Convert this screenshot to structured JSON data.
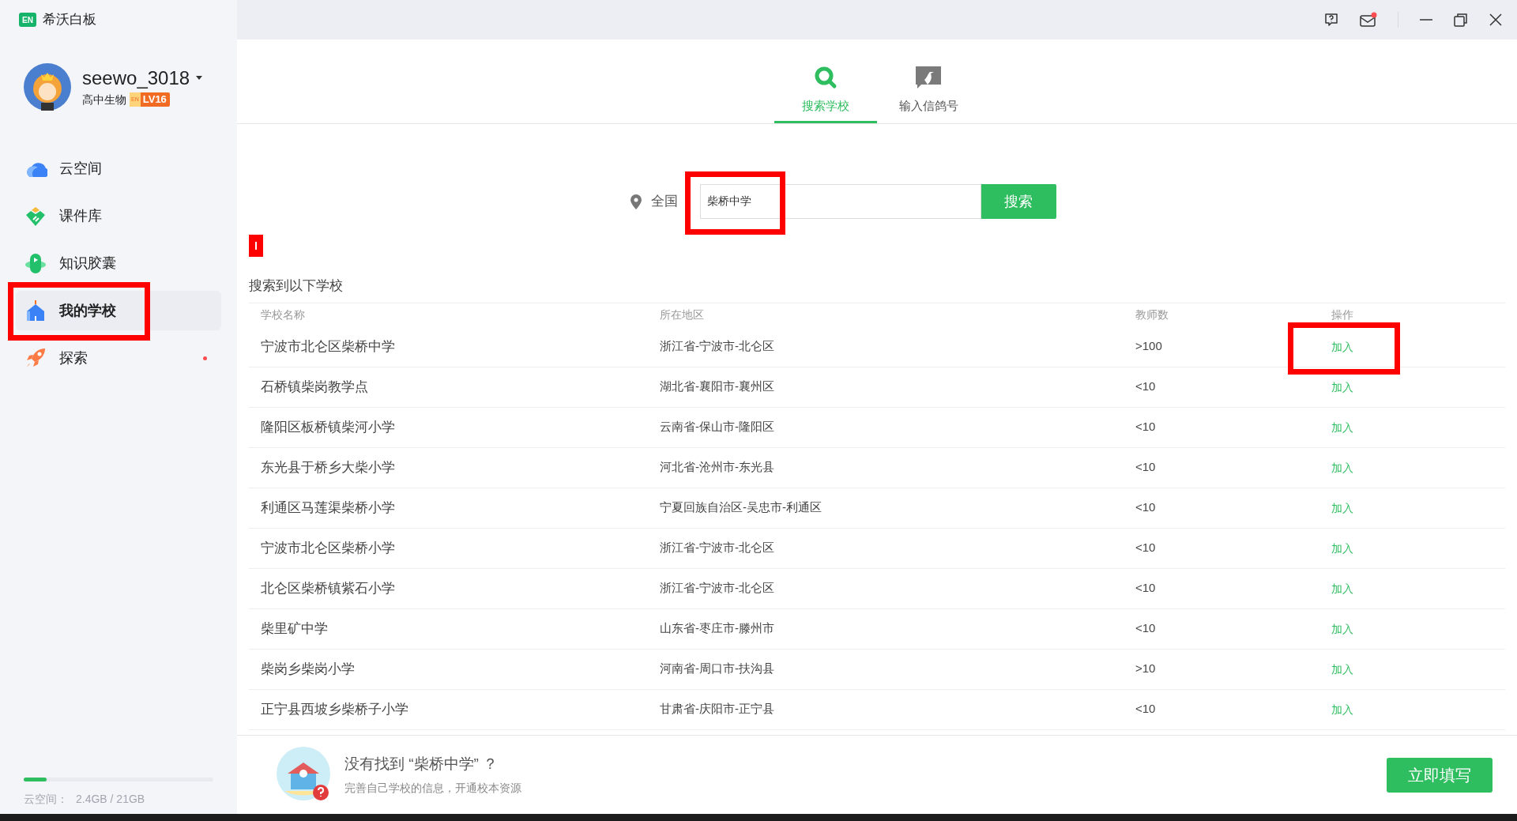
{
  "app": {
    "title": "希沃白板",
    "logo": "EN"
  },
  "window_controls": {
    "mail_unread": true
  },
  "user": {
    "name": "seewo_3018",
    "subject": "高中生物",
    "badge_logo": "EN",
    "level": "LV16"
  },
  "sidebar": {
    "items": [
      {
        "label": "云空间",
        "selected": false,
        "highlighted": false,
        "dot": false
      },
      {
        "label": "课件库",
        "selected": false,
        "highlighted": false,
        "dot": false
      },
      {
        "label": "知识胶囊",
        "selected": false,
        "highlighted": false,
        "dot": false
      },
      {
        "label": "我的学校",
        "selected": true,
        "highlighted": true,
        "dot": false
      },
      {
        "label": "探索",
        "selected": false,
        "highlighted": false,
        "dot": true
      }
    ]
  },
  "storage": {
    "level": 0.12,
    "label": "云空间：",
    "usage": "2.4GB / 21GB"
  },
  "tabs": [
    {
      "label": "搜索学校",
      "selected": true
    },
    {
      "label": "输入信鸽号",
      "selected": false
    }
  ],
  "search": {
    "region": "全国",
    "value": "柴桥中学",
    "highlighted": true,
    "button": "搜索"
  },
  "result_marker": true,
  "results_title": "搜索到以下学校",
  "table": {
    "columns": [
      "学校名称",
      "所在地区",
      "教师数",
      "操作"
    ],
    "rows": [
      {
        "name": "宁波市北仑区柴桥中学",
        "region": "浙江省-宁波市-北仑区",
        "teachers": ">100",
        "action": "加入",
        "action_highlighted": true
      },
      {
        "name": "石桥镇柴岗教学点",
        "region": "湖北省-襄阳市-襄州区",
        "teachers": "<10",
        "action": "加入",
        "action_highlighted": false
      },
      {
        "name": "隆阳区板桥镇柴河小学",
        "region": "云南省-保山市-隆阳区",
        "teachers": "<10",
        "action": "加入",
        "action_highlighted": false
      },
      {
        "name": "东光县于桥乡大柴小学",
        "region": "河北省-沧州市-东光县",
        "teachers": "<10",
        "action": "加入",
        "action_highlighted": false
      },
      {
        "name": "利通区马莲渠柴桥小学",
        "region": "宁夏回族自治区-吴忠市-利通区",
        "teachers": "<10",
        "action": "加入",
        "action_highlighted": false
      },
      {
        "name": "宁波市北仑区柴桥小学",
        "region": "浙江省-宁波市-北仑区",
        "teachers": "<10",
        "action": "加入",
        "action_highlighted": false
      },
      {
        "name": "北仑区柴桥镇紫石小学",
        "region": "浙江省-宁波市-北仑区",
        "teachers": "<10",
        "action": "加入",
        "action_highlighted": false
      },
      {
        "name": "柴里矿中学",
        "region": "山东省-枣庄市-滕州市",
        "teachers": "<10",
        "action": "加入",
        "action_highlighted": false
      },
      {
        "name": "柴岗乡柴岗小学",
        "region": "河南省-周口市-扶沟县",
        "teachers": ">10",
        "action": "加入",
        "action_highlighted": false
      },
      {
        "name": "正宁县西坡乡柴桥子小学",
        "region": "甘肃省-庆阳市-正宁县",
        "teachers": "<10",
        "action": "加入",
        "action_highlighted": false
      }
    ]
  },
  "footer": {
    "title": "没有找到 “柴桥中学” ？",
    "subtitle": "完善自己学校的信息，开通校本资源",
    "button": "立即填写"
  }
}
